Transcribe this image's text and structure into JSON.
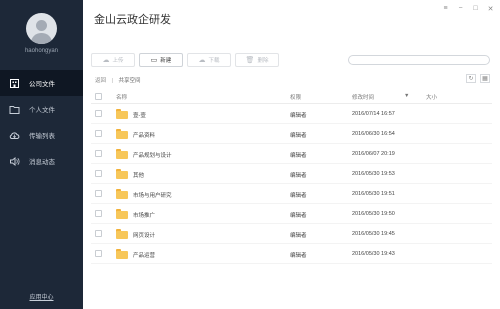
{
  "sidebar": {
    "username": "haohongyan",
    "items": [
      {
        "label": "公司文件",
        "icon": "building-icon",
        "active": true
      },
      {
        "label": "个人文件",
        "icon": "folder-icon",
        "active": false
      },
      {
        "label": "传输列表",
        "icon": "cloud-transfer-icon",
        "active": false
      },
      {
        "label": "消息动态",
        "icon": "speaker-icon",
        "active": false
      }
    ],
    "help": "应用中心"
  },
  "window": {
    "title": "金山云政企研发"
  },
  "toolbar": {
    "upload": "上传",
    "new": "新建",
    "download": "下载",
    "delete": "删除"
  },
  "breadcrumb": {
    "back": "返回",
    "current": "共享空间"
  },
  "table": {
    "headers": {
      "name": "名称",
      "permission": "权限",
      "modified": "修改时间",
      "size": "大小"
    },
    "rows": [
      {
        "name": "壹-壹",
        "permission": "编辑者",
        "modified": "2016/07/14 16:57"
      },
      {
        "name": "产品资料",
        "permission": "编辑者",
        "modified": "2016/06/30 16:54"
      },
      {
        "name": "产品规划与设计",
        "permission": "编辑者",
        "modified": "2016/06/07 20:19"
      },
      {
        "name": "其他",
        "permission": "编辑者",
        "modified": "2016/05/30 19:53"
      },
      {
        "name": "市场与用户研究",
        "permission": "编辑者",
        "modified": "2016/05/30 19:51"
      },
      {
        "name": "市场推广",
        "permission": "编辑者",
        "modified": "2016/05/30 19:50"
      },
      {
        "name": "网页设计",
        "permission": "编辑者",
        "modified": "2016/05/30 19:45"
      },
      {
        "name": "产品运营",
        "permission": "编辑者",
        "modified": "2016/05/30 19:43"
      }
    ]
  },
  "colors": {
    "sidebar_bg": "#1d2838",
    "sidebar_active": "#0f1723",
    "folder": "#f7c75a"
  }
}
